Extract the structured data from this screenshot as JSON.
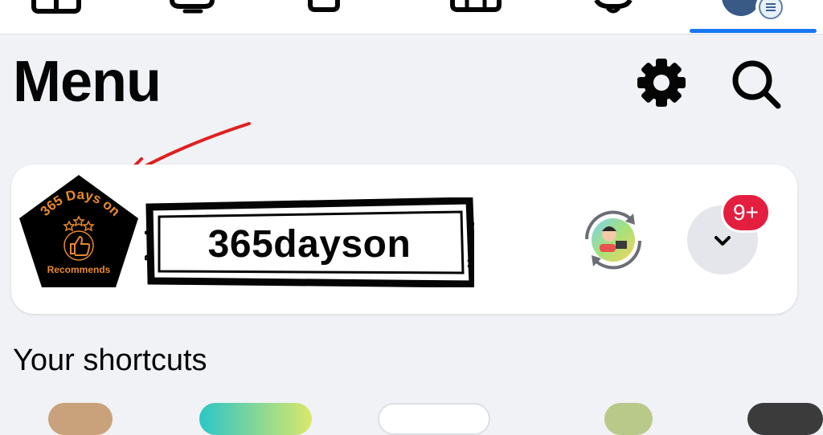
{
  "header": {
    "title": "Menu"
  },
  "profile": {
    "name": "365dayson",
    "logo_text_top": "365 Days on",
    "logo_text_bottom": "Recommends",
    "notification_count": "9+"
  },
  "sections": {
    "shortcuts_title": "Your shortcuts"
  },
  "nav": {
    "items": [
      {
        "icon": "home-icon"
      },
      {
        "icon": "video-icon"
      },
      {
        "icon": "marketplace-icon"
      },
      {
        "icon": "store-icon"
      },
      {
        "icon": "bell-icon"
      },
      {
        "icon": "profile-menu-icon",
        "active": true
      }
    ]
  },
  "colors": {
    "accent": "#1877f2",
    "badge": "#e41e3f",
    "background": "#f0f2f5",
    "annotation_arrow": "#e02020"
  }
}
